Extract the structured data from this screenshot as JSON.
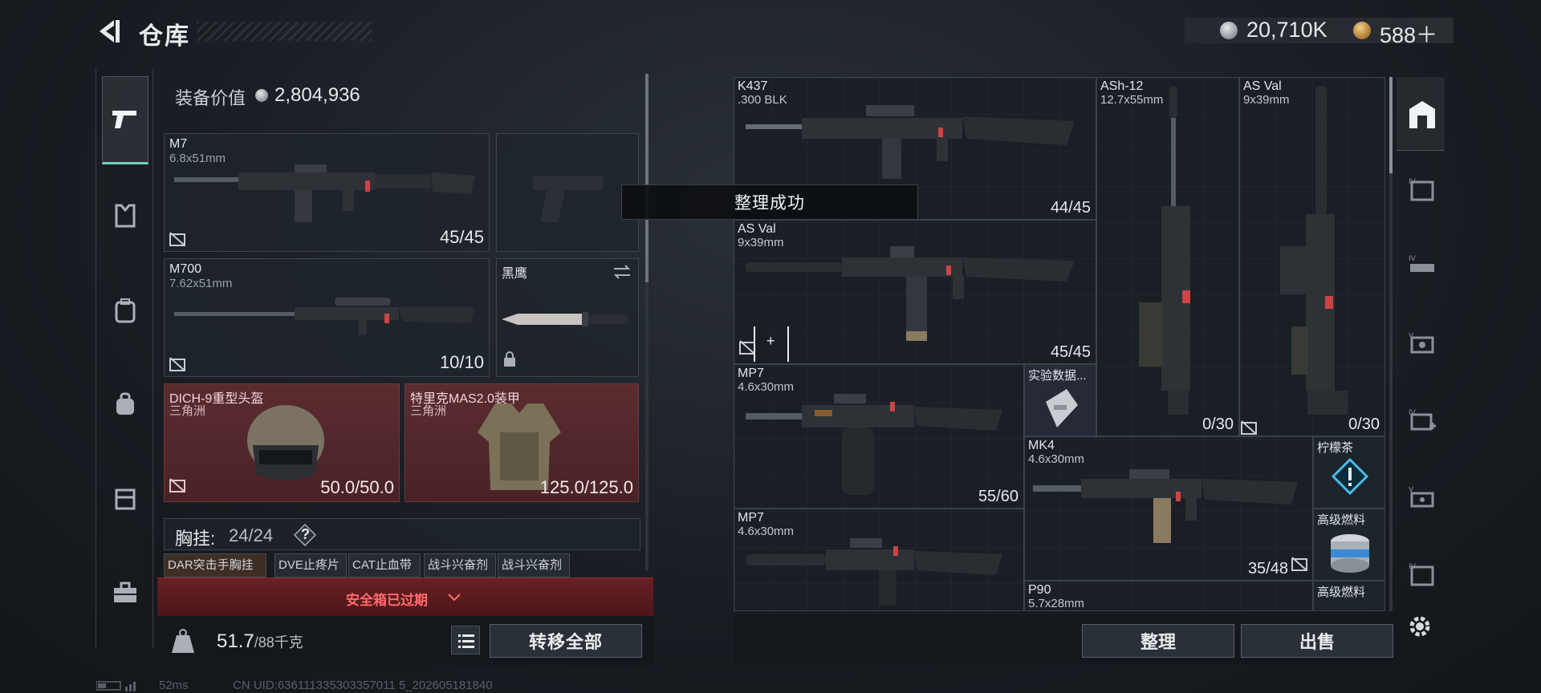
{
  "header": {
    "title": "仓库"
  },
  "currency": {
    "silver": "20,710K",
    "gold": "588＋"
  },
  "left_tabs": [
    "weapons",
    "armor",
    "backpack",
    "bag",
    "case",
    "toolbox"
  ],
  "equipment": {
    "value_label": "装备价值",
    "value": "2,804,936",
    "primary": {
      "name": "M7",
      "caliber": "6.8x51mm",
      "ammo": "45/45"
    },
    "secondary": {
      "name": "M700",
      "caliber": "7.62x51mm",
      "ammo": "10/10"
    },
    "knife": {
      "name": "黑鹰"
    },
    "helmet": {
      "name": "DICH-9重型头盔",
      "origin": "三角洲",
      "durability": "50.0/50.0"
    },
    "armor": {
      "name": "特里克MAS2.0装甲",
      "origin": "三角洲",
      "durability": "125.0/125.0"
    },
    "chest": {
      "label": "胸挂:",
      "count": "24/24",
      "help": "?"
    },
    "chest_items": [
      "DAR突击手胸挂",
      "DVE止疼片",
      "CAT止血带",
      "战斗兴奋剂",
      "战斗兴奋剂"
    ],
    "safe_box": "安全箱已过期",
    "weight": "51.7",
    "weight_max": "/88千克",
    "transfer_all": "转移全部"
  },
  "toast": "整理成功",
  "stash": {
    "items": [
      {
        "name": "K437",
        "caliber": ".300 BLK",
        "ammo": "44/45"
      },
      {
        "name": "ASh-12",
        "caliber": "12.7x55mm",
        "ammo": "0/30"
      },
      {
        "name": "AS Val",
        "caliber": "9x39mm",
        "ammo": "0/30"
      },
      {
        "name": "AS Val",
        "caliber": "9x39mm",
        "ammo": "45/45"
      },
      {
        "name": "MP7",
        "caliber": "4.6x30mm",
        "ammo": "55/60"
      },
      {
        "name": "实验数据..."
      },
      {
        "name": "MK4",
        "caliber": "4.6x30mm",
        "ammo": "35/48"
      },
      {
        "name": "柠檬茶"
      },
      {
        "name": "MP7",
        "caliber": "4.6x30mm"
      },
      {
        "name": "高级燃料"
      },
      {
        "name": "P90",
        "caliber": "5.7x28mm"
      },
      {
        "name": "高级燃料"
      }
    ],
    "sort_button": "整理",
    "sell_button": "出售"
  },
  "status": {
    "ping": "52ms",
    "uid": "CN UID:636111335303357011 5_202605181840"
  }
}
